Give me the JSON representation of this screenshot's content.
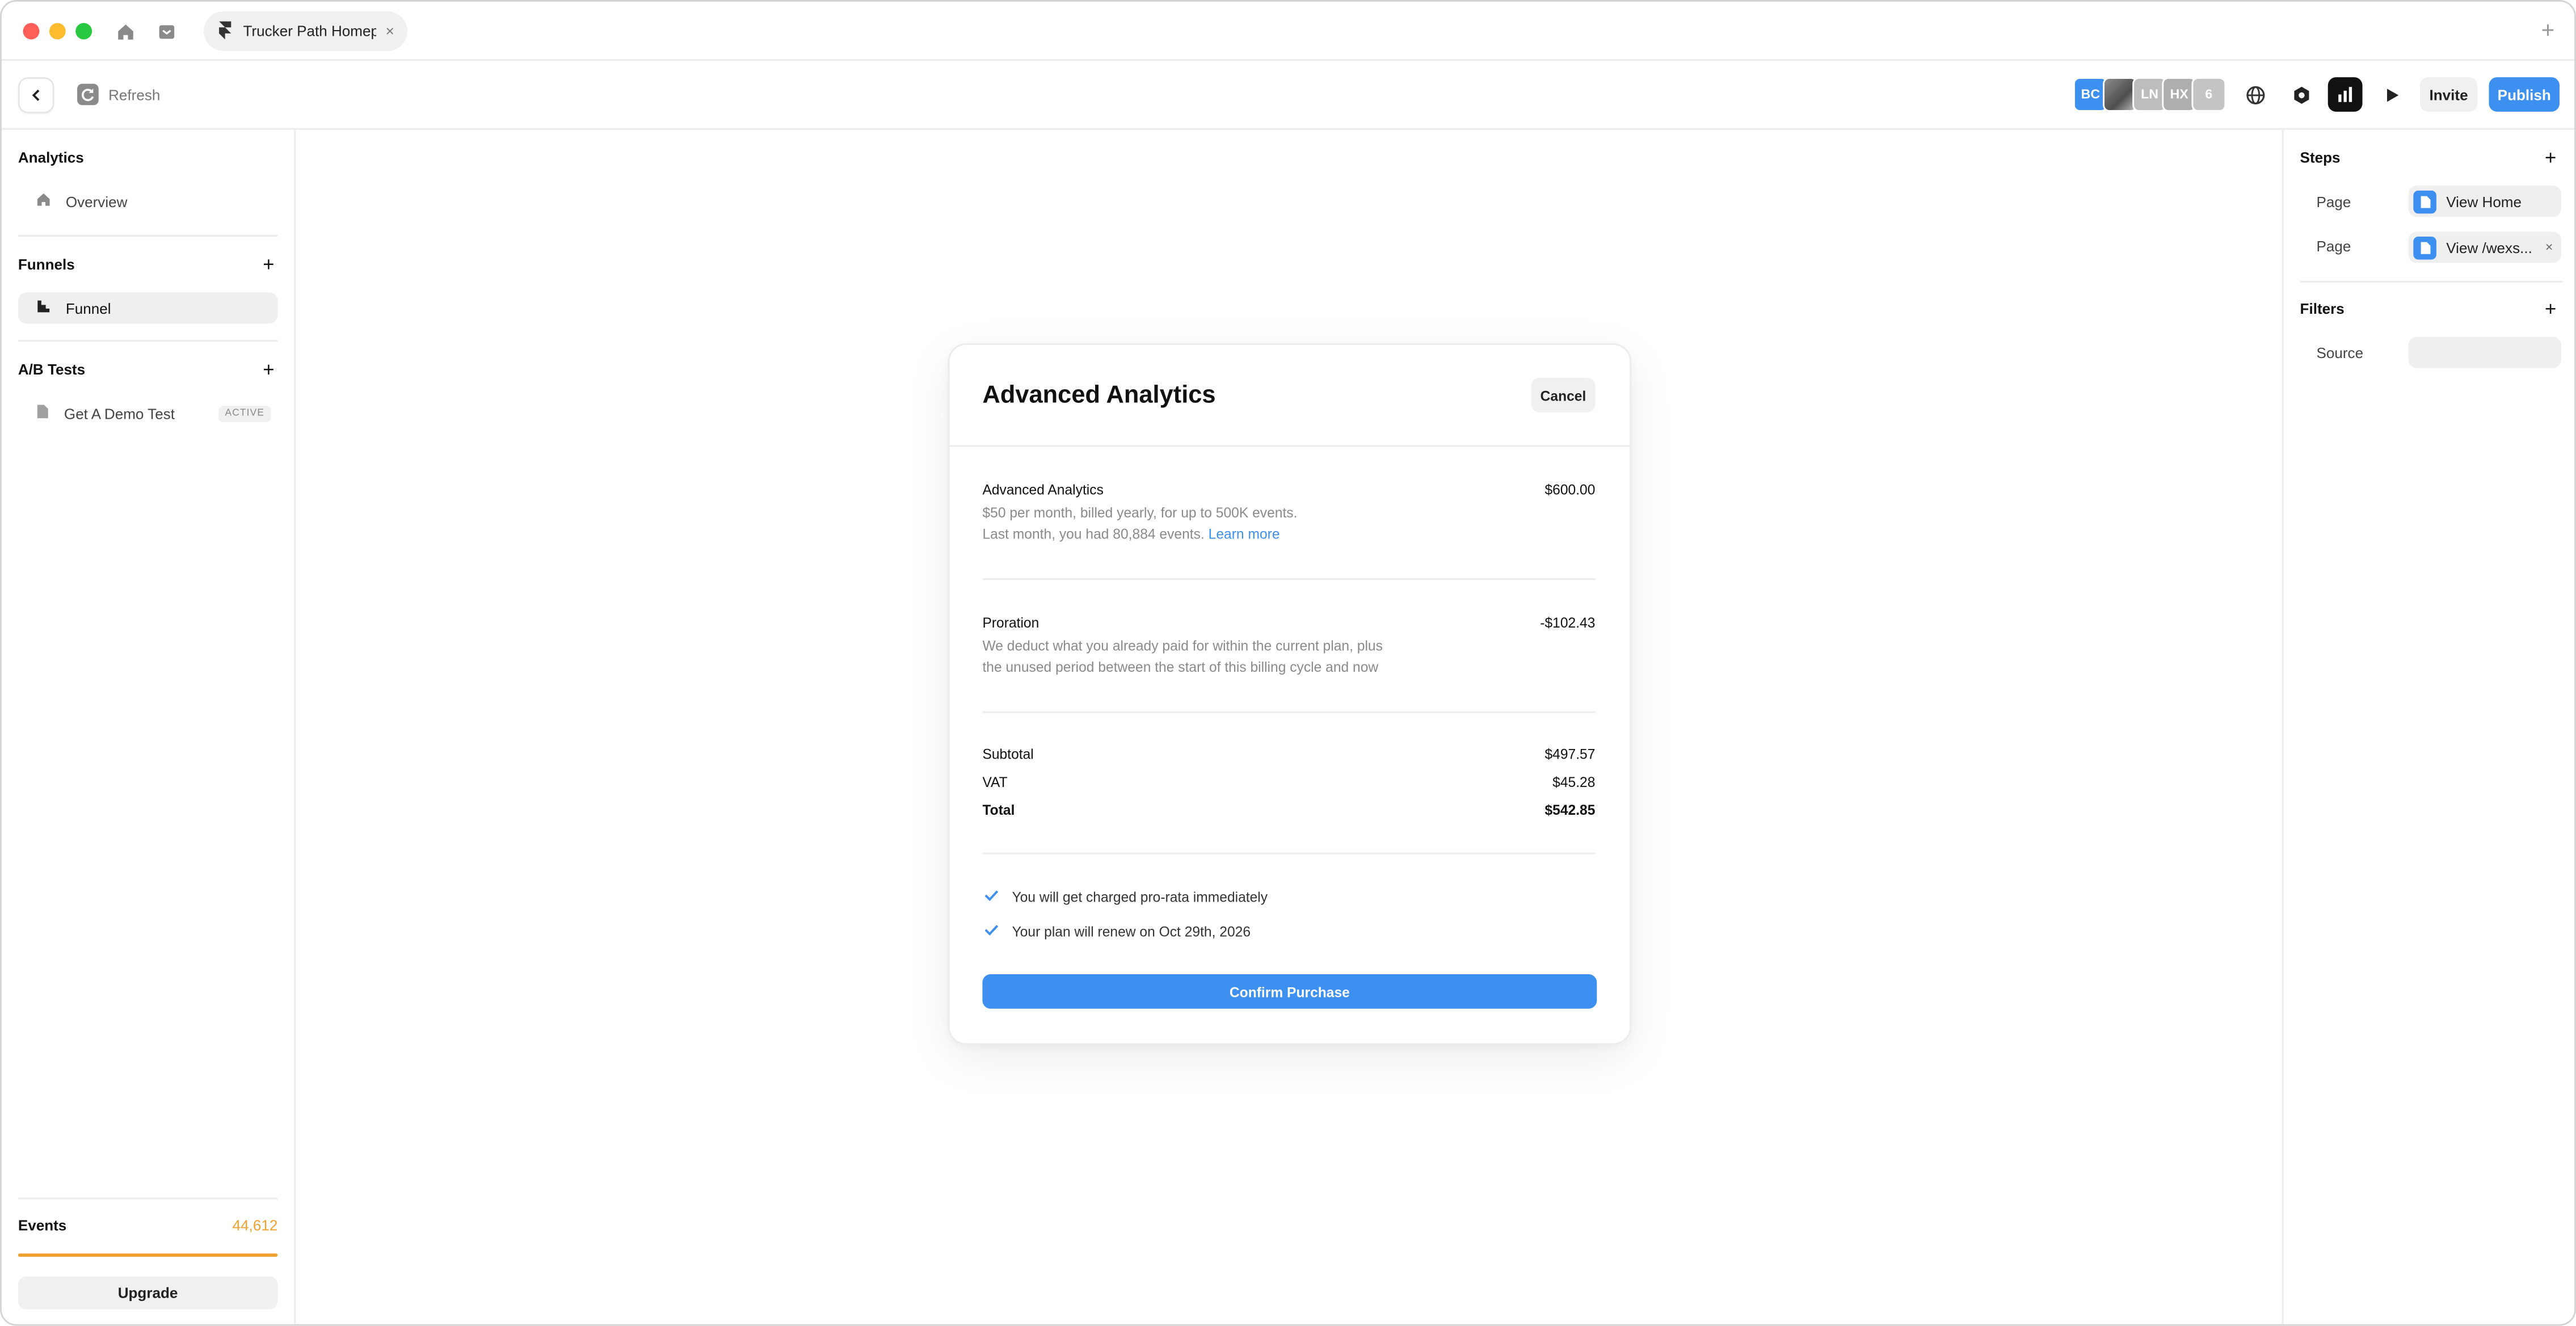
{
  "window": {
    "tab_title": "Trucker Path Homep...",
    "tab_close": "×",
    "new_tab": "+"
  },
  "toolbar": {
    "refresh_label": "Refresh",
    "avatars": [
      "BC",
      "LN",
      "HX"
    ],
    "avatar_count": "6",
    "invite_label": "Invite",
    "publish_label": "Publish"
  },
  "sidebar": {
    "analytics_title": "Analytics",
    "overview_label": "Overview",
    "funnels_title": "Funnels",
    "funnels_plus": "+",
    "funnel_label": "Funnel",
    "ab_title": "A/B Tests",
    "ab_plus": "+",
    "ab_item_label": "Get A Demo Test",
    "ab_item_badge": "ACTIVE",
    "events_label": "Events",
    "events_count": "44,612",
    "upgrade_label": "Upgrade"
  },
  "right_panel": {
    "steps_title": "Steps",
    "steps_plus": "+",
    "steps": [
      {
        "type": "Page",
        "value": "View Home"
      },
      {
        "type": "Page",
        "value": "View /wexs..."
      }
    ],
    "step_remove": "×",
    "filters_title": "Filters",
    "filters_plus": "+",
    "filter_source_label": "Source"
  },
  "modal": {
    "title": "Advanced Analytics",
    "cancel_label": "Cancel",
    "plan": {
      "name": "Advanced Analytics",
      "amount": "$600.00",
      "desc_line1": "$50 per month, billed yearly, for up to 500K events.",
      "desc_line2": "Last month, you had 80,884 events.",
      "learn_more": "Learn more"
    },
    "proration": {
      "name": "Proration",
      "amount": "-$102.43",
      "desc_line1": "We deduct what you already paid for within the current plan, plus",
      "desc_line2": "the unused period between the start of this billing cycle and now"
    },
    "subtotal_label": "Subtotal",
    "subtotal_amount": "$497.57",
    "vat_label": "VAT",
    "vat_amount": "$45.28",
    "total_label": "Total",
    "total_amount": "$542.85",
    "notes": [
      "You will get charged pro-rata immediately",
      "Your plan will renew on Oct 29th, 2026"
    ],
    "confirm_label": "Confirm Purchase"
  },
  "colors": {
    "accent": "#3d8ff0",
    "events_accent": "#f0a030"
  },
  "icons": {
    "titlebar": [
      "home-icon",
      "inbox-icon",
      "framer-logo-icon"
    ],
    "toolbar": [
      "chevron-left-icon",
      "refresh-icon",
      "globe-icon",
      "settings-icon",
      "analytics-icon",
      "play-icon"
    ],
    "sidebar": [
      "home-icon",
      "funnel-icon",
      "page-icon"
    ],
    "right_panel": [
      "page-icon"
    ],
    "modal": [
      "check-icon"
    ]
  }
}
